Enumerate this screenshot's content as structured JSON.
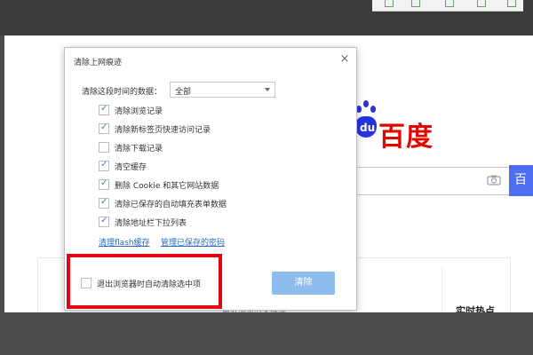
{
  "dialog": {
    "title": "清除上网痕迹",
    "close_glyph": "×",
    "time_label": "清除这段时间的数据：",
    "time_value": "全部",
    "options": [
      {
        "label": "清除浏览记录",
        "checked": true
      },
      {
        "label": "清除新标签页快速访问记录",
        "checked": true
      },
      {
        "label": "清除下载记录",
        "checked": false
      },
      {
        "label": "清空缓存",
        "checked": true
      },
      {
        "label": "删除 Cookie 和其它网站数据",
        "checked": true
      },
      {
        "label": "清除已保存的自动填充表单数据",
        "checked": true
      },
      {
        "label": "清除地址栏下拉列表",
        "checked": true
      }
    ],
    "link_flash": "清理flash缓存",
    "link_passwords": "管理已保存的密码",
    "exit_option": {
      "label": "退出浏览器时自动清除选中项",
      "checked": false
    },
    "clear_button": "清除"
  },
  "baidu": {
    "logo_text": "百度",
    "paw_text": "du",
    "search_button": "百",
    "hot_title": "实时热点",
    "hint_text": "最近浏览的关键词"
  },
  "colors": {
    "baidu_blue": "#2932e1",
    "baidu_red": "#e10602",
    "highlight_red": "#e30613",
    "button_blue": "#8fbcef"
  }
}
